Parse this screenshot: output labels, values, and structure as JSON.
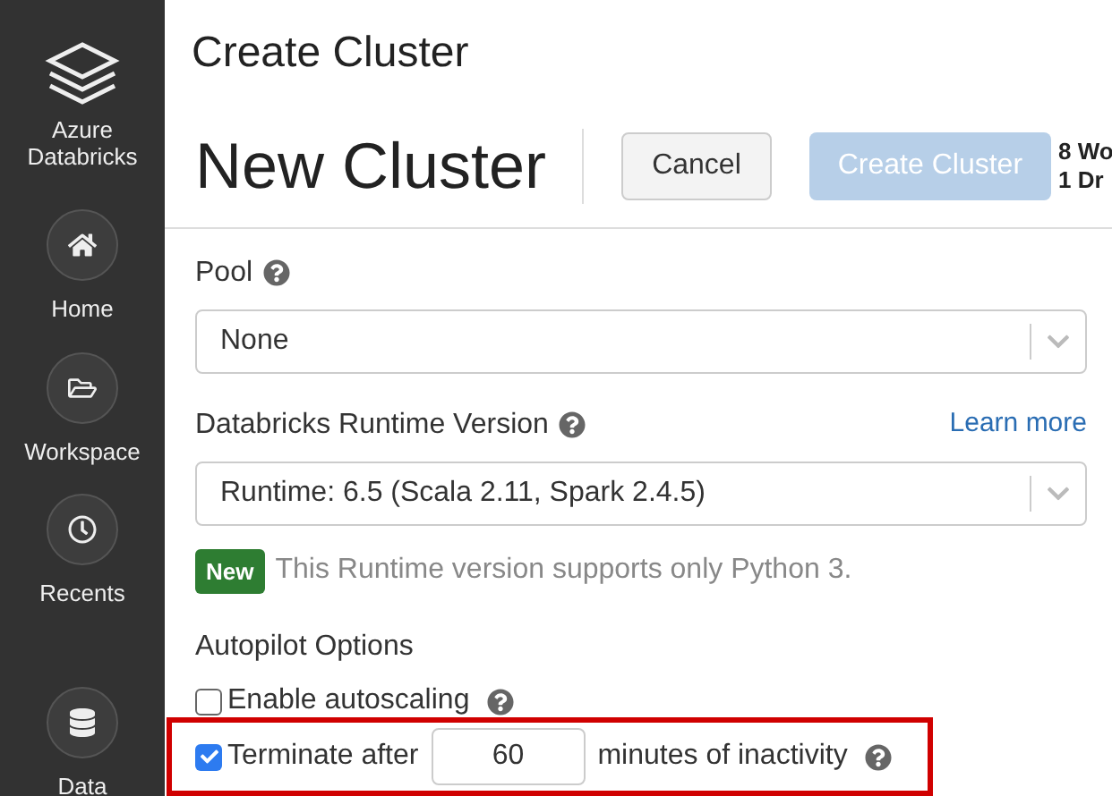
{
  "sidebar": {
    "brand": "Azure Databricks",
    "items": [
      {
        "kind": "home",
        "label": "Home"
      },
      {
        "kind": "workspace",
        "label": "Workspace"
      },
      {
        "kind": "recents",
        "label": "Recents"
      },
      {
        "kind": "data",
        "label": "Data"
      }
    ]
  },
  "page_title": "Create Cluster",
  "header": {
    "title": "New Cluster",
    "buttons": [
      {
        "label": "Cancel",
        "disabled": false
      },
      {
        "label": "Create Cluster",
        "disabled": true
      }
    ],
    "summary": [
      "8 Wo",
      "1 Dr"
    ]
  },
  "pool": {
    "label": "Pool",
    "value": "None"
  },
  "runtime": {
    "label": "Databricks Runtime Version",
    "link": "Learn more",
    "value": "Runtime: 6.5 (Scala 2.11, Spark 2.4.5)",
    "badge": "New",
    "note": "This Runtime version supports only Python 3."
  },
  "autopilot": {
    "label": "Autopilot Options",
    "options": [
      {
        "kind": "checkbox",
        "label": "Enable autoscaling",
        "checked": false,
        "highlighted": false
      },
      {
        "kind": "timeout",
        "label": "Terminate after",
        "value": "60",
        "suffix": "minutes of inactivity",
        "checked": true,
        "highlighted": true
      }
    ]
  }
}
